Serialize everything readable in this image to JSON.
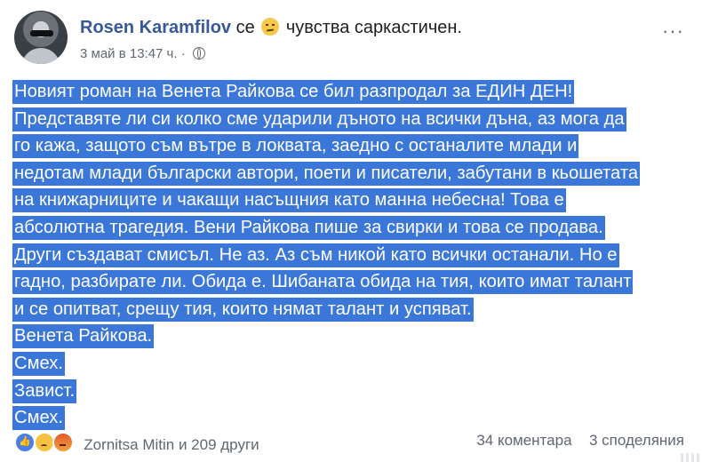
{
  "post": {
    "author": "Rosen Karamfilov",
    "feeling_prefix": "се",
    "feeling_text": "чувства саркастичен.",
    "timestamp": "3 май в 13:47 ч. ·",
    "text_lines": [
      "Новият роман на Венета Райкова се бил разпродал за ЕДИН ДЕН!",
      "Представяте ли си колко сме ударили дъното на всички дъна, аз мога да",
      "го кажа, защото съм вътре в локвата, заедно с останалите млади и",
      "недотам млади български автори, поети и писатели, забутани в кьошетата",
      "на книжарниците и чакащи насъщния като манна небесна! Това е",
      "абсолютна трагедия. Вени Райкова пише за свирки и това се продава.",
      "Други създават смисъл. Не аз. Аз съм никой като всички останали. Но е",
      "гадно, разбирате ли. Обида е. Шибаната обида на тия, които имат талант",
      "и се опитват, срещу тия, които нямат талант и успяват.",
      "Венета Райкова.",
      "Смех.",
      "Завист.",
      "Смех."
    ]
  },
  "footer": {
    "reactions_text": "Zornitsa Mitin и 209 други",
    "comments": "34 коментара",
    "shares": "3 споделяния"
  },
  "icons": {
    "reactions": [
      "like-icon",
      "sad-icon",
      "angry-icon"
    ],
    "privacy": "globe-icon",
    "menu": "more-options-icon",
    "feeling": "smirk-emoji-icon"
  },
  "colors": {
    "author": "#385898",
    "selection_highlight": "#3b77d8",
    "meta": "#616770"
  }
}
